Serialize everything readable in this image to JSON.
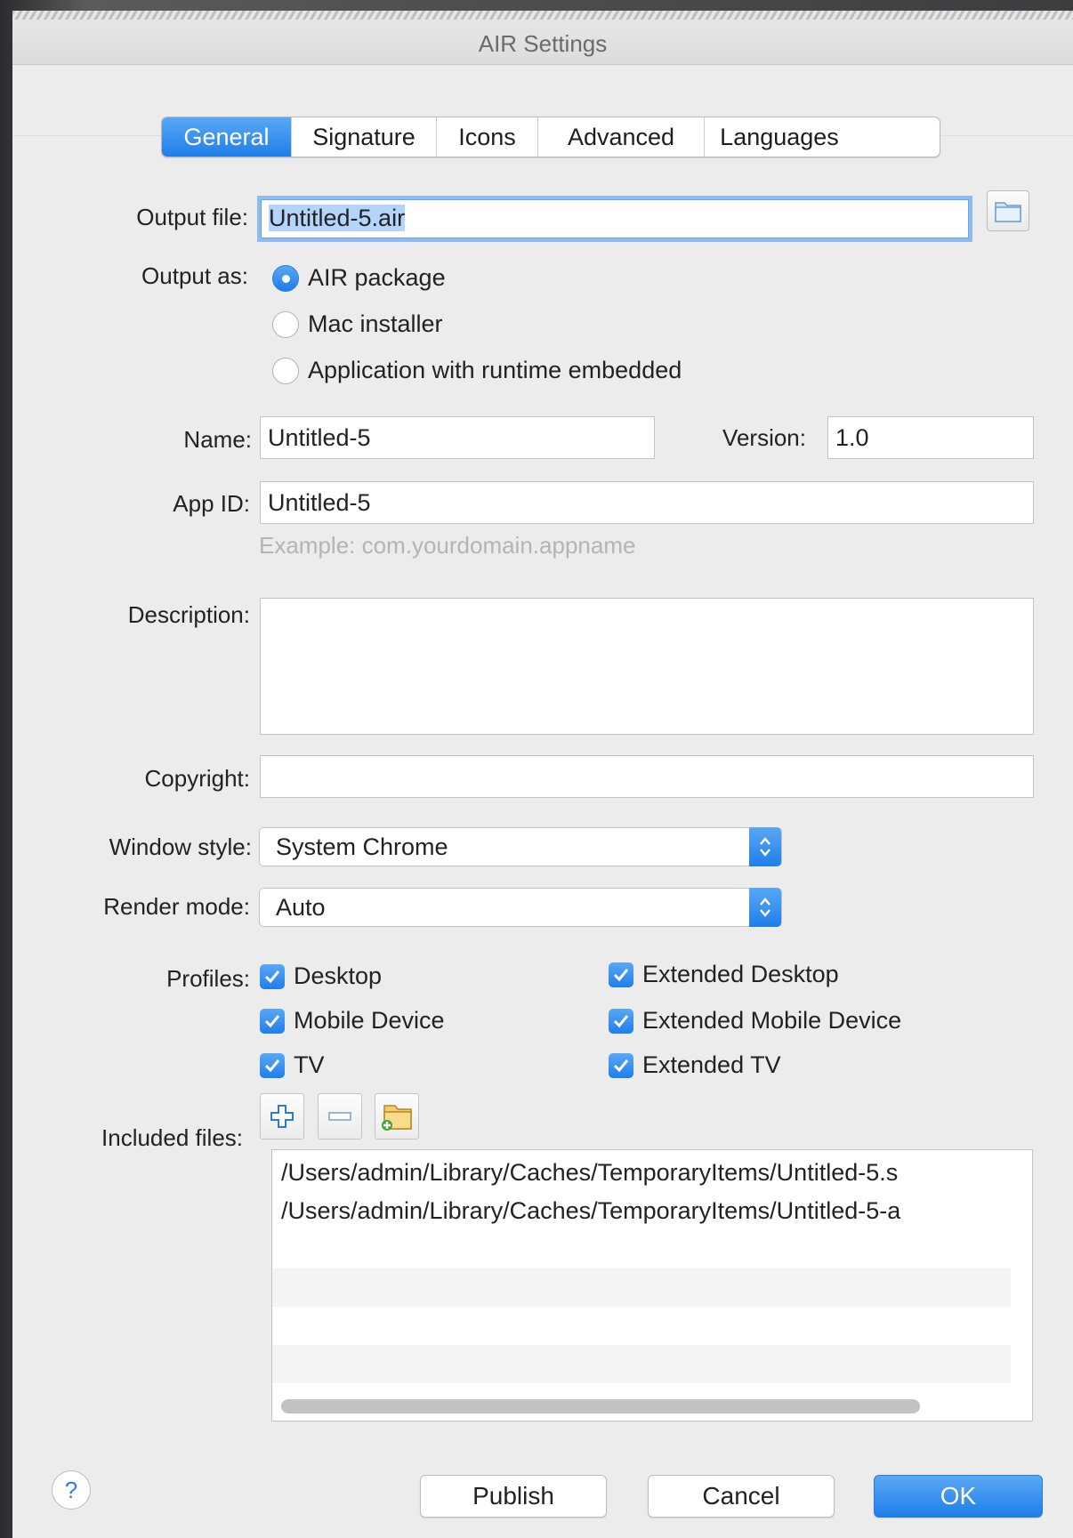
{
  "window": {
    "title": "AIR Settings"
  },
  "tabs": [
    {
      "label": "General",
      "active": true
    },
    {
      "label": "Signature",
      "active": false
    },
    {
      "label": "Icons",
      "active": false
    },
    {
      "label": "Advanced",
      "active": false
    },
    {
      "label": "Languages",
      "active": false
    }
  ],
  "output_file": {
    "label": "Output file:",
    "value": "Untitled-5.air",
    "browse_icon": "folder-icon"
  },
  "output_as": {
    "label": "Output as:",
    "options": [
      {
        "label": "AIR package",
        "selected": true
      },
      {
        "label": "Mac installer",
        "selected": false
      },
      {
        "label": "Application with runtime embedded",
        "selected": false
      }
    ]
  },
  "name": {
    "label": "Name:",
    "value": "Untitled-5"
  },
  "version": {
    "label": "Version:",
    "value": "1.0"
  },
  "app_id": {
    "label": "App ID:",
    "value": "Untitled-5",
    "hint": "Example: com.yourdomain.appname"
  },
  "description": {
    "label": "Description:",
    "value": ""
  },
  "copyright": {
    "label": "Copyright:",
    "value": ""
  },
  "window_style": {
    "label": "Window style:",
    "value": "System Chrome"
  },
  "render_mode": {
    "label": "Render mode:",
    "value": "Auto"
  },
  "profiles": {
    "label": "Profiles:",
    "items": [
      {
        "label": "Desktop",
        "checked": true
      },
      {
        "label": "Mobile Device",
        "checked": true
      },
      {
        "label": "TV",
        "checked": true
      },
      {
        "label": "Extended Desktop",
        "checked": true
      },
      {
        "label": "Extended Mobile Device",
        "checked": true
      },
      {
        "label": "Extended TV",
        "checked": true
      }
    ]
  },
  "included_files": {
    "label": "Included files:",
    "tool_icons": [
      "plus-icon",
      "minus-icon",
      "add-folder-icon"
    ],
    "files": [
      "/Users/admin/Library/Caches/TemporaryItems/Untitled-5.s",
      "/Users/admin/Library/Caches/TemporaryItems/Untitled-5-a"
    ]
  },
  "footer": {
    "help_label": "?",
    "publish_label": "Publish",
    "cancel_label": "Cancel",
    "ok_label": "OK"
  },
  "colors": {
    "accent": "#1f7ee9",
    "window_bg": "#ececec",
    "hint": "#b4b4b4"
  }
}
